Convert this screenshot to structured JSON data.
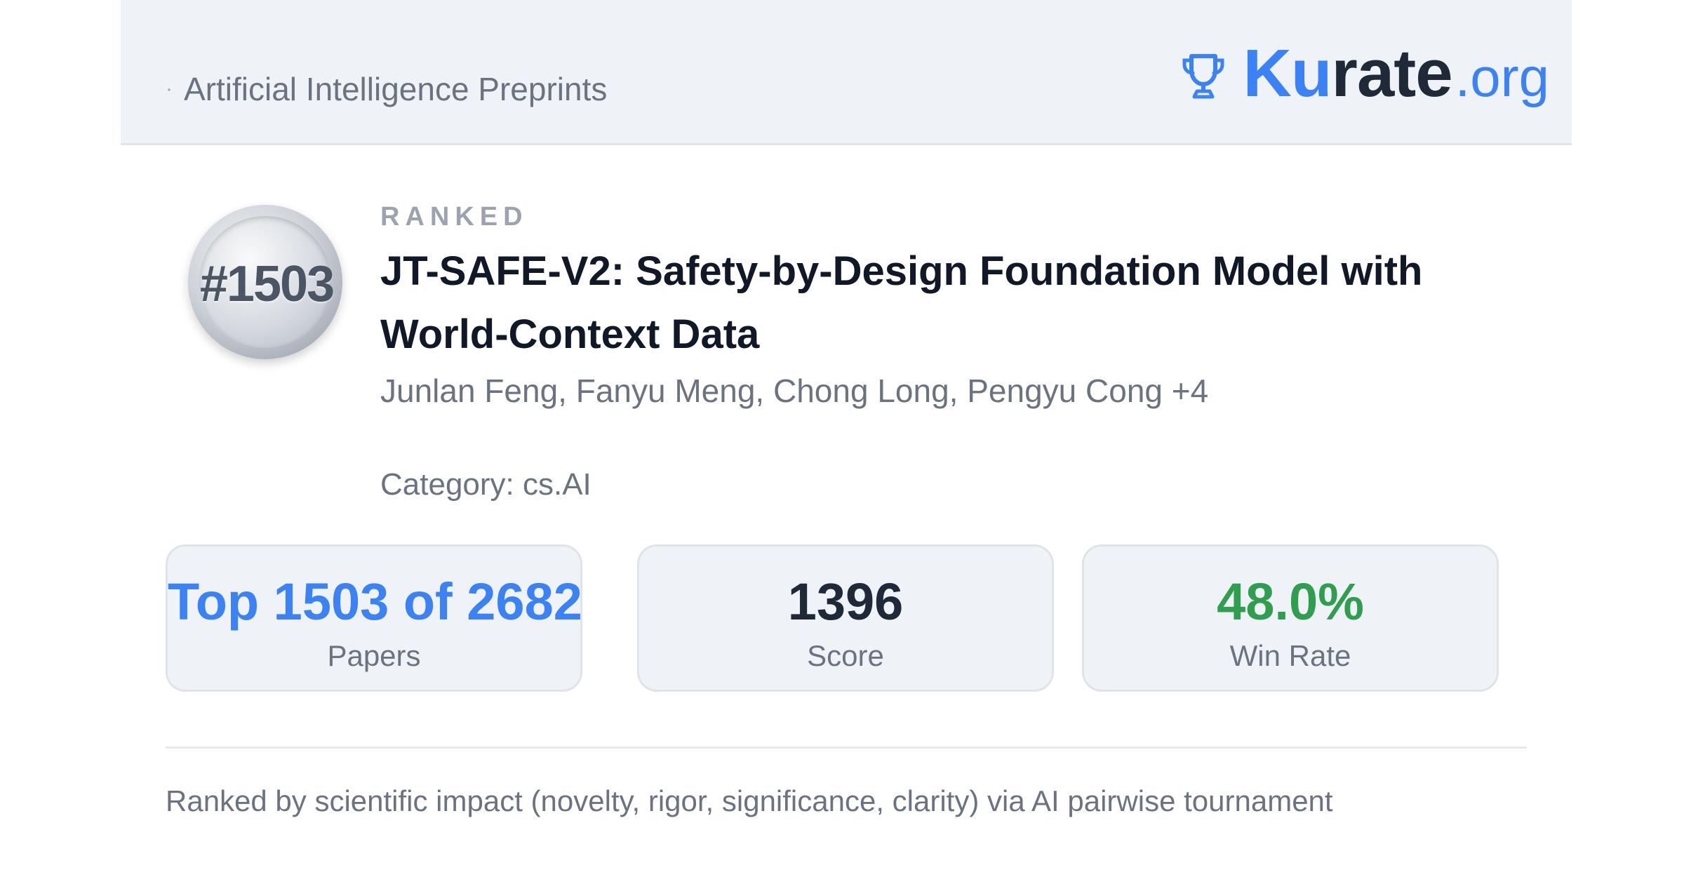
{
  "header": {
    "site_label": "Artificial Intelligence Preprints",
    "brand": {
      "part1": "Ku",
      "part2": "rate",
      "part3": ".org",
      "icon": "trophy-icon"
    }
  },
  "paper": {
    "rank_badge": "#1503",
    "ranked_label": "RANKED",
    "title": "JT-SAFE-V2: Safety-by-Design Foundation Model with World-Context Data",
    "authors": "Junlan Feng, Fanyu Meng, Chong Long, Pengyu Cong +4",
    "category": "Category: cs.AI"
  },
  "stats": [
    {
      "value": "Top 1503 of 2682",
      "label": "Papers",
      "color": "#3b82f6"
    },
    {
      "value": "1396",
      "label": "Score",
      "color": "#1f2937"
    },
    {
      "value": "48.0%",
      "label": "Win Rate",
      "color": "#2f9e4f"
    }
  ],
  "footer": {
    "note": "Ranked by scientific impact (novelty, rigor, significance, clarity) via AI pairwise tournament"
  },
  "colors": {
    "accent": "#3b82f6",
    "header_bg": "#eff2f7",
    "text_dark": "#111827",
    "text_muted": "#6b7280"
  }
}
